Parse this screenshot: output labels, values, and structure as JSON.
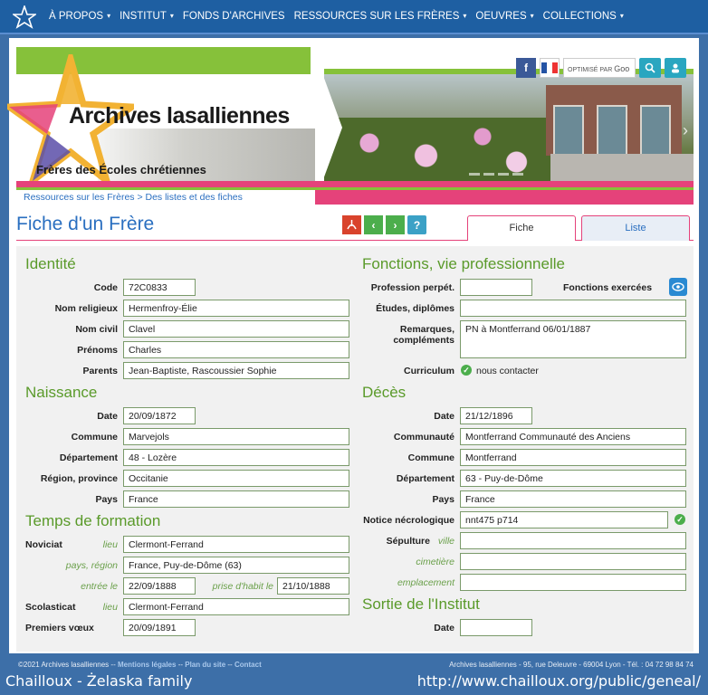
{
  "nav": {
    "items": [
      "À PROPOS",
      "INSTITUT",
      "FONDS D'ARCHIVES",
      "RESSOURCES SUR LES FRÈRES",
      "OEUVRES",
      "COLLECTIONS"
    ],
    "caret": "▾"
  },
  "banner": {
    "title": "Archives lasalliennes",
    "subtitle": "Frères des Écoles chrétiennes",
    "breadcrumb": "Ressources sur les Frères > Des listes et des fiches",
    "search_label": "OPTIMISÉ PAR",
    "search_brand": "Goo"
  },
  "page": {
    "title": "Fiche d'un Frère",
    "tabs": [
      "Fiche",
      "Liste"
    ]
  },
  "sections": {
    "identite": "Identité",
    "fonctions": "Fonctions, vie professionnelle",
    "naissance": "Naissance",
    "deces": "Décès",
    "formation": "Temps de formation",
    "sortie": "Sortie de l'Institut"
  },
  "identite": {
    "code_label": "Code",
    "code": "72C0833",
    "nom_rel_label": "Nom religieux",
    "nom_rel": "Hermenfroy-Élie",
    "nom_civil_label": "Nom civil",
    "nom_civil": "Clavel",
    "prenoms_label": "Prénoms",
    "prenoms": "Charles",
    "parents_label": "Parents",
    "parents": "Jean-Baptiste, Rascoussier Sophie"
  },
  "fonctions": {
    "prof_label": "Profession perpét.",
    "prof": "",
    "fonctions_label": "Fonctions exercées",
    "etudes_label": "Études, diplômes",
    "etudes": "",
    "remarques_label_1": "Remarques,",
    "remarques_label_2": "compléments",
    "remarques": "PN à Montferrand 06/01/1887",
    "curriculum_label": "Curriculum",
    "curriculum": "nous contacter"
  },
  "naissance": {
    "date_label": "Date",
    "date": "20/09/1872",
    "commune_label": "Commune",
    "commune": "Marvejols",
    "dep_label": "Département",
    "dep": "48   - Lozère",
    "region_label": "Région, province",
    "region": "Occitanie",
    "pays_label": "Pays",
    "pays": "France"
  },
  "deces": {
    "date_label": "Date",
    "date": "21/12/1896",
    "communaute_label": "Communauté",
    "communaute": "Montferrand Communauté des Anciens",
    "commune_label": "Commune",
    "commune": "Montferrand",
    "dep_label": "Département",
    "dep": "63   - Puy-de-Dôme",
    "pays_label": "Pays",
    "pays": "France",
    "notice_label": "Notice nécrologique",
    "notice": "nnt475 p714",
    "sepulture_label": "Sépulture",
    "ville_label": "ville",
    "ville": "",
    "cimetiere_label": "cimetière",
    "cimetiere": "",
    "emplacement_label": "emplacement",
    "emplacement": ""
  },
  "formation": {
    "noviciat_label": "Noviciat",
    "lieu_label": "lieu",
    "noviciat_lieu": "Clermont-Ferrand",
    "pays_region_label": "pays, région",
    "pays_region": "France, Puy-de-Dôme (63)",
    "entree_label": "entrée le",
    "entree": "22/09/1888",
    "habit_label": "prise d'habit le",
    "habit": "21/10/1888",
    "scolasticat_label": "Scolasticat",
    "scolasticat_lieu_label": "lieu",
    "scolasticat_lieu": "Clermont-Ferrand",
    "voeux_label": "Premiers vœux",
    "voeux": "20/09/1891"
  },
  "sortie": {
    "date_label": "Date",
    "date": ""
  },
  "footer": {
    "copyright": "©2021 Archives lasalliennes",
    "sep": "--",
    "mentions": "Mentions légales",
    "plan": "Plan du site",
    "contact": "Contact",
    "address": "Archives lasalliennes - 95, rue Deleuvre - 69004 Lyon - Tél. : 04 72 98 84 74"
  },
  "watermark": {
    "left": "Chailloux - Żelaska  family",
    "right": "http://www.chailloux.org/public/geneal/"
  },
  "colors": {
    "nav_bg": "#1e5fa2",
    "accent_green": "#86c13a",
    "accent_pink": "#e5427a",
    "section_green": "#5a9a2a",
    "link_blue": "#2a6fc0"
  }
}
